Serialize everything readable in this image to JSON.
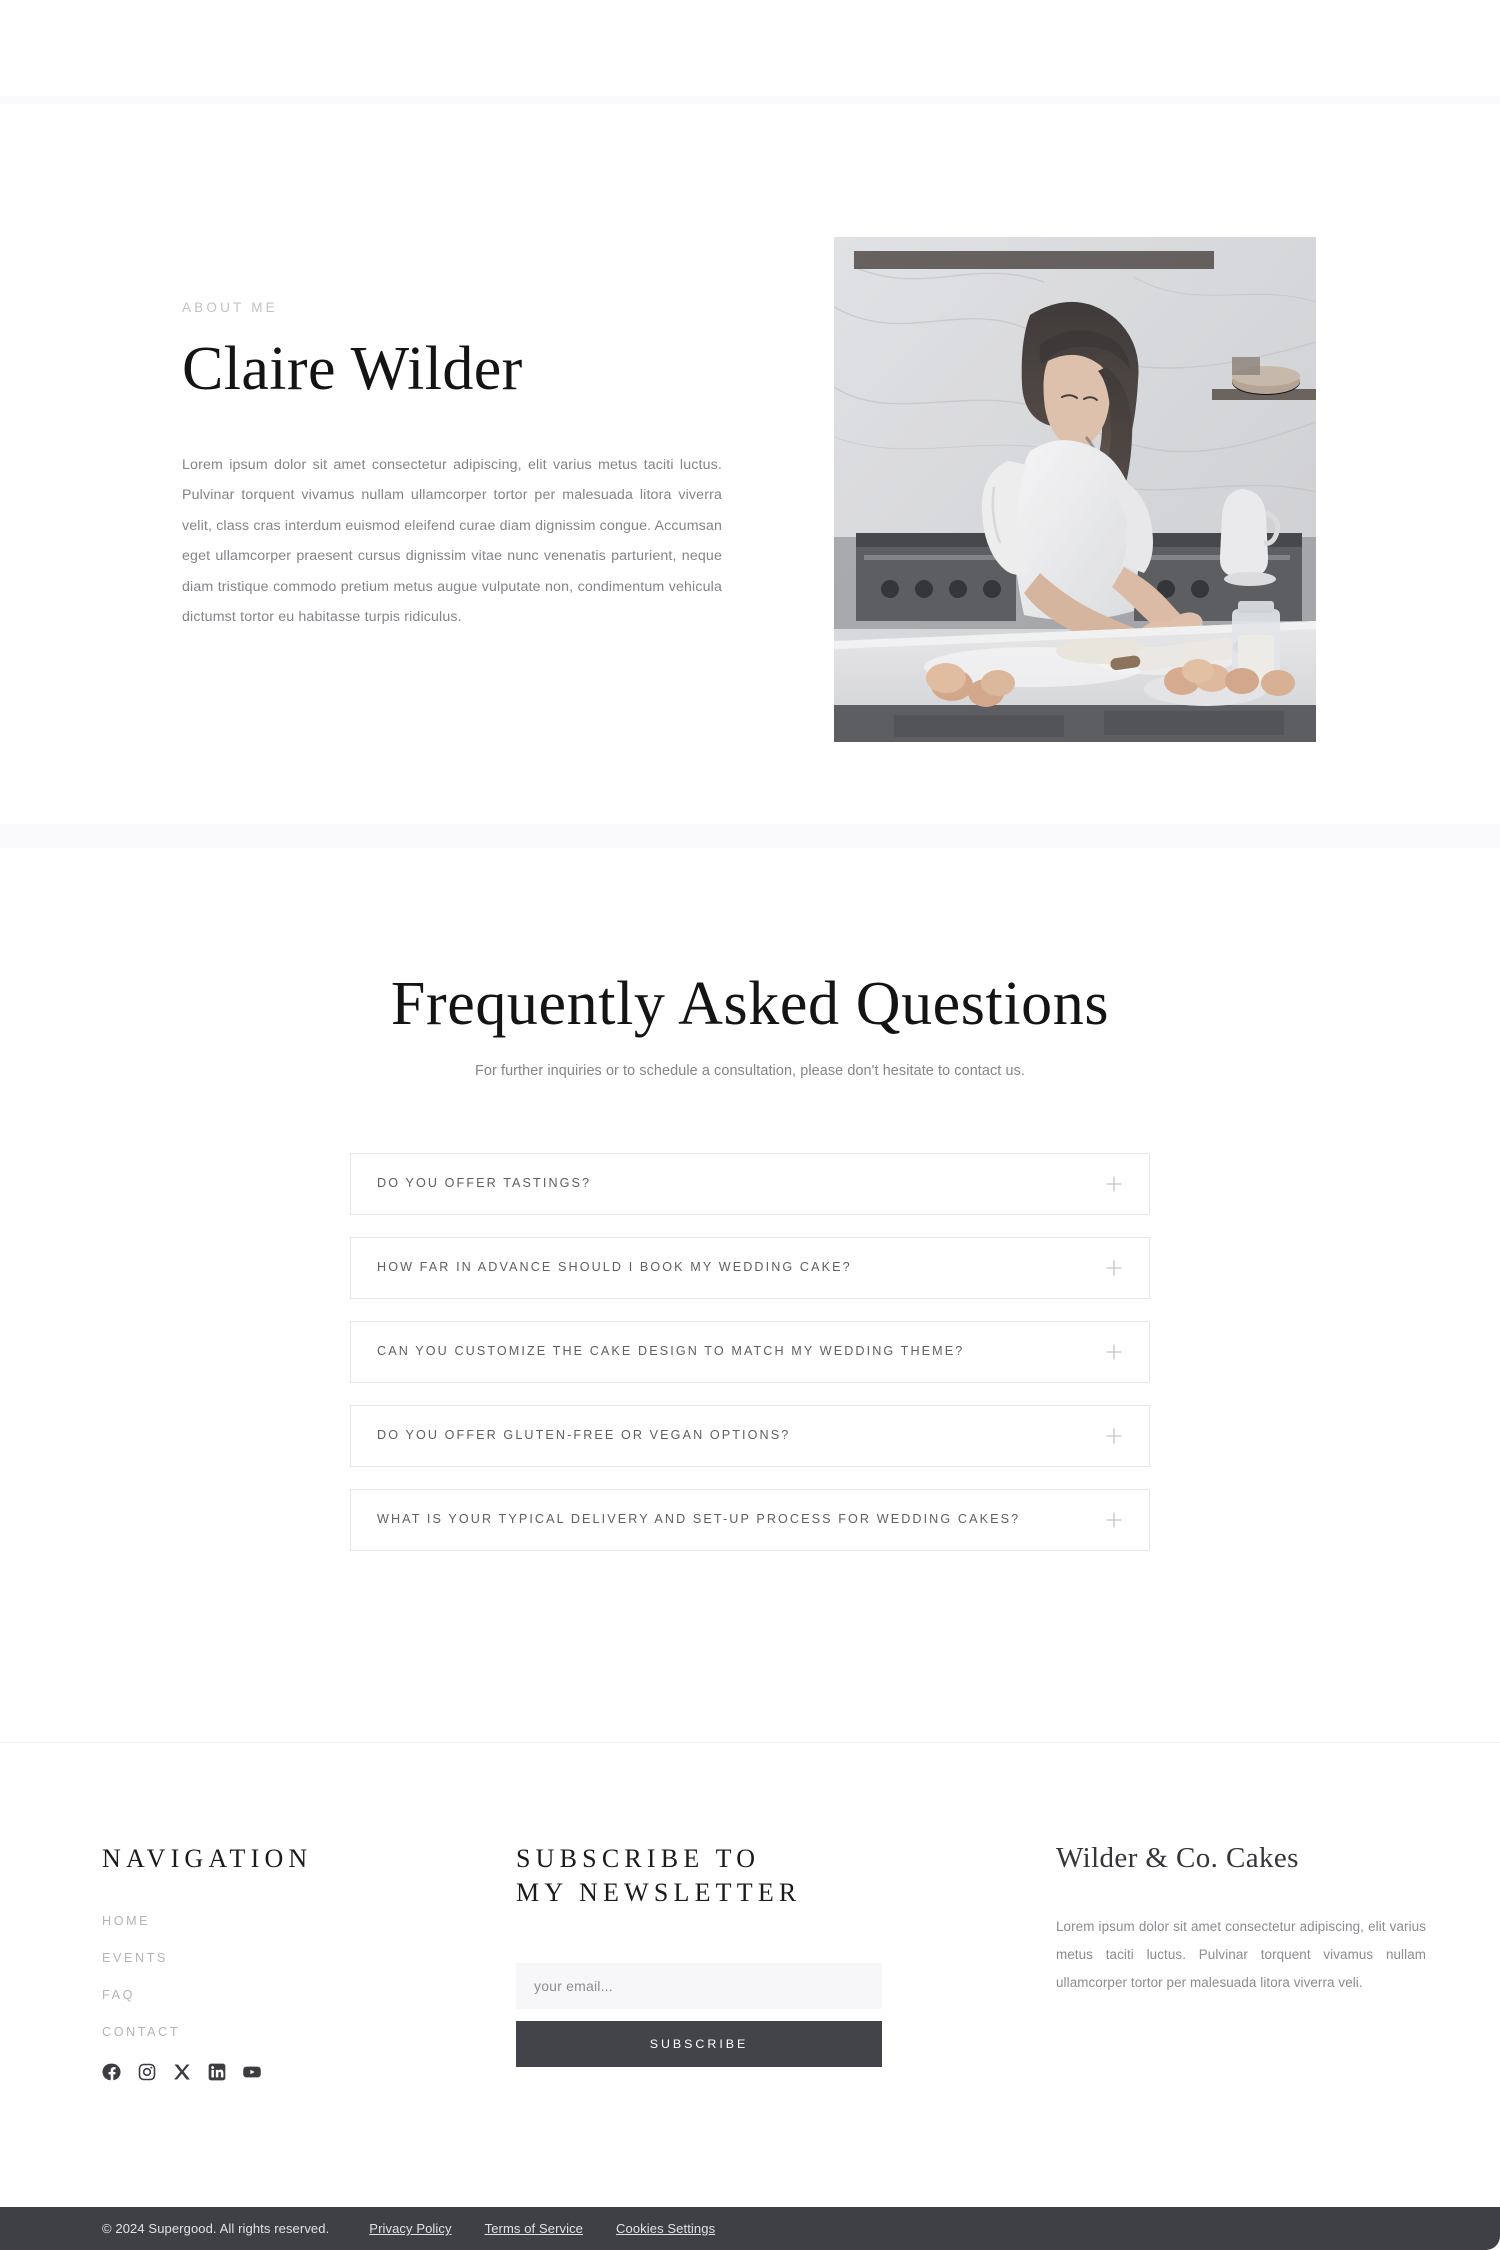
{
  "about": {
    "eyebrow": "ABOUT ME",
    "name": "Claire Wilder",
    "paragraph": "Lorem ipsum dolor sit amet consectetur adipiscing, elit varius metus taciti luctus. Pulvinar torquent vivamus nullam ullamcorper tortor per malesuada litora viverra velit, class cras interdum euismod eleifend curae diam dignissim congue. Accumsan eget ullamcorper praesent cursus dignissim vitae nunc venenatis parturient, neque diam tristique commodo pretium metus augue vulputate non, condimentum vehicula dictumst tortor eu habitasse turpis ridiculus.",
    "photo_alt": "baker-rolling-dough-photo"
  },
  "faq": {
    "title": "Frequently Asked Questions",
    "subtitle": "For further inquiries or to schedule a consultation, please don't hesitate to contact us.",
    "items": [
      {
        "question": "DO YOU OFFER TASTINGS?",
        "icon": "plus-icon"
      },
      {
        "question": "HOW FAR IN ADVANCE SHOULD I BOOK MY WEDDING CAKE?",
        "icon": "plus-icon"
      },
      {
        "question": "CAN YOU CUSTOMIZE THE CAKE DESIGN TO MATCH MY WEDDING THEME?",
        "icon": "plus-icon"
      },
      {
        "question": "DO YOU OFFER GLUTEN-FREE OR VEGAN OPTIONS?",
        "icon": "plus-icon"
      },
      {
        "question": "WHAT IS YOUR TYPICAL DELIVERY AND SET-UP PROCESS FOR WEDDING CAKES?",
        "icon": "plus-icon"
      }
    ]
  },
  "footer": {
    "nav": {
      "heading": "NAVIGATION",
      "links": [
        {
          "label": "HOME"
        },
        {
          "label": "EVENTS"
        },
        {
          "label": "FAQ"
        },
        {
          "label": "CONTACT"
        }
      ]
    },
    "socials": [
      {
        "name": "facebook-icon"
      },
      {
        "name": "instagram-icon"
      },
      {
        "name": "x-icon"
      },
      {
        "name": "linkedin-icon"
      },
      {
        "name": "youtube-icon"
      }
    ],
    "newsletter": {
      "heading_line1": "SUBSCRIBE TO",
      "heading_line2": "MY NEWSLETTER",
      "email_placeholder": "your email...",
      "email_value": "",
      "button_label": "SUBSCRIBE"
    },
    "brand": {
      "name": "Wilder & Co. Cakes",
      "description": "Lorem ipsum dolor sit amet consectetur adipiscing, elit varius metus taciti luctus. Pulvinar torquent vivamus nullam ullamcorper tortor per malesuada litora viverra veli."
    }
  },
  "bottom_bar": {
    "copyright": "© 2024 Supergood. All rights reserved.",
    "links": [
      {
        "label": "Privacy Policy"
      },
      {
        "label": "Terms of Service"
      },
      {
        "label": "Cookies Settings"
      }
    ]
  },
  "colors": {
    "page_bg": "#ffffff",
    "band_tint": "#fafafc",
    "heading": "#141416",
    "body_text": "#84848a",
    "muted": "#b4b4b8",
    "eyebrow": "#c2c2c6",
    "border": "#e6e6e8",
    "button_dark": "#43434a",
    "bottom_bar": "#3f4045",
    "input_bg": "#f7f7f9"
  }
}
